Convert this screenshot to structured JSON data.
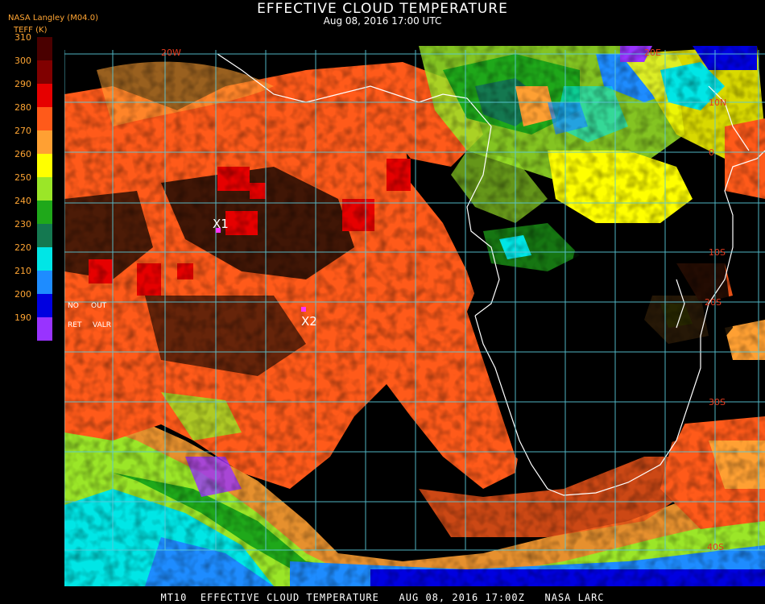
{
  "header": {
    "title": "EFFECTIVE CLOUD TEMPERATURE",
    "subtitle": "Aug 08, 2016 17:00 UTC",
    "agency": "NASA Langley (M04.0)",
    "units_label": "TEFF (K)"
  },
  "colorbar": {
    "labels": [
      "310",
      "300",
      "290",
      "280",
      "270",
      "260",
      "250",
      "240",
      "230",
      "220",
      "210",
      "200",
      "190"
    ],
    "swatches": [
      "#4a0000",
      "#800000",
      "#e60000",
      "#ff5a1a",
      "#ffa033",
      "#ffff00",
      "#9be628",
      "#1fa81a",
      "#147850",
      "#00e6e6",
      "#1e8cff",
      "#0000e0",
      "#9933ff"
    ]
  },
  "map": {
    "markers": [
      {
        "label": "X1",
        "color": "#ff33ff"
      },
      {
        "label": "X2",
        "color": "#ff33ff"
      }
    ],
    "grid_labels": [
      "20W",
      "20E",
      "10N",
      "0",
      "10S",
      "20S",
      "30S",
      "40S"
    ],
    "legend_notes": [
      "NO",
      "OUT",
      "RET",
      "VALR"
    ]
  },
  "footer": {
    "text": "MT10  EFFECTIVE CLOUD TEMPERATURE   AUG 08, 2016 17:00Z   NASA LARC"
  }
}
